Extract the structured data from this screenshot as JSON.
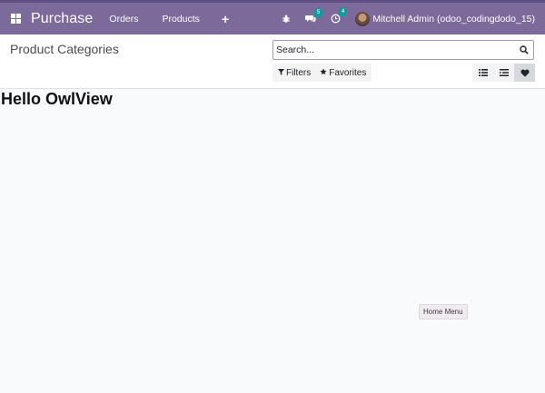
{
  "topbar": {
    "app_name": "Purchase",
    "menu": [
      {
        "label": "Orders"
      },
      {
        "label": "Products"
      }
    ],
    "new_symbol": "+",
    "messages_count": "5",
    "activities_count": "4",
    "user_name": "Mitchell Admin (odoo_codingdodo_15)"
  },
  "control_panel": {
    "breadcrumb": "Product Categories",
    "search_placeholder": "Search...",
    "filters_label": "Filters",
    "favorites_label": "Favorites"
  },
  "content": {
    "heading": "Hello OwlView"
  },
  "tooltip": {
    "text": "Home Menu"
  },
  "colors": {
    "navbar": "#7c6a9b",
    "badge": "#00a09d"
  }
}
